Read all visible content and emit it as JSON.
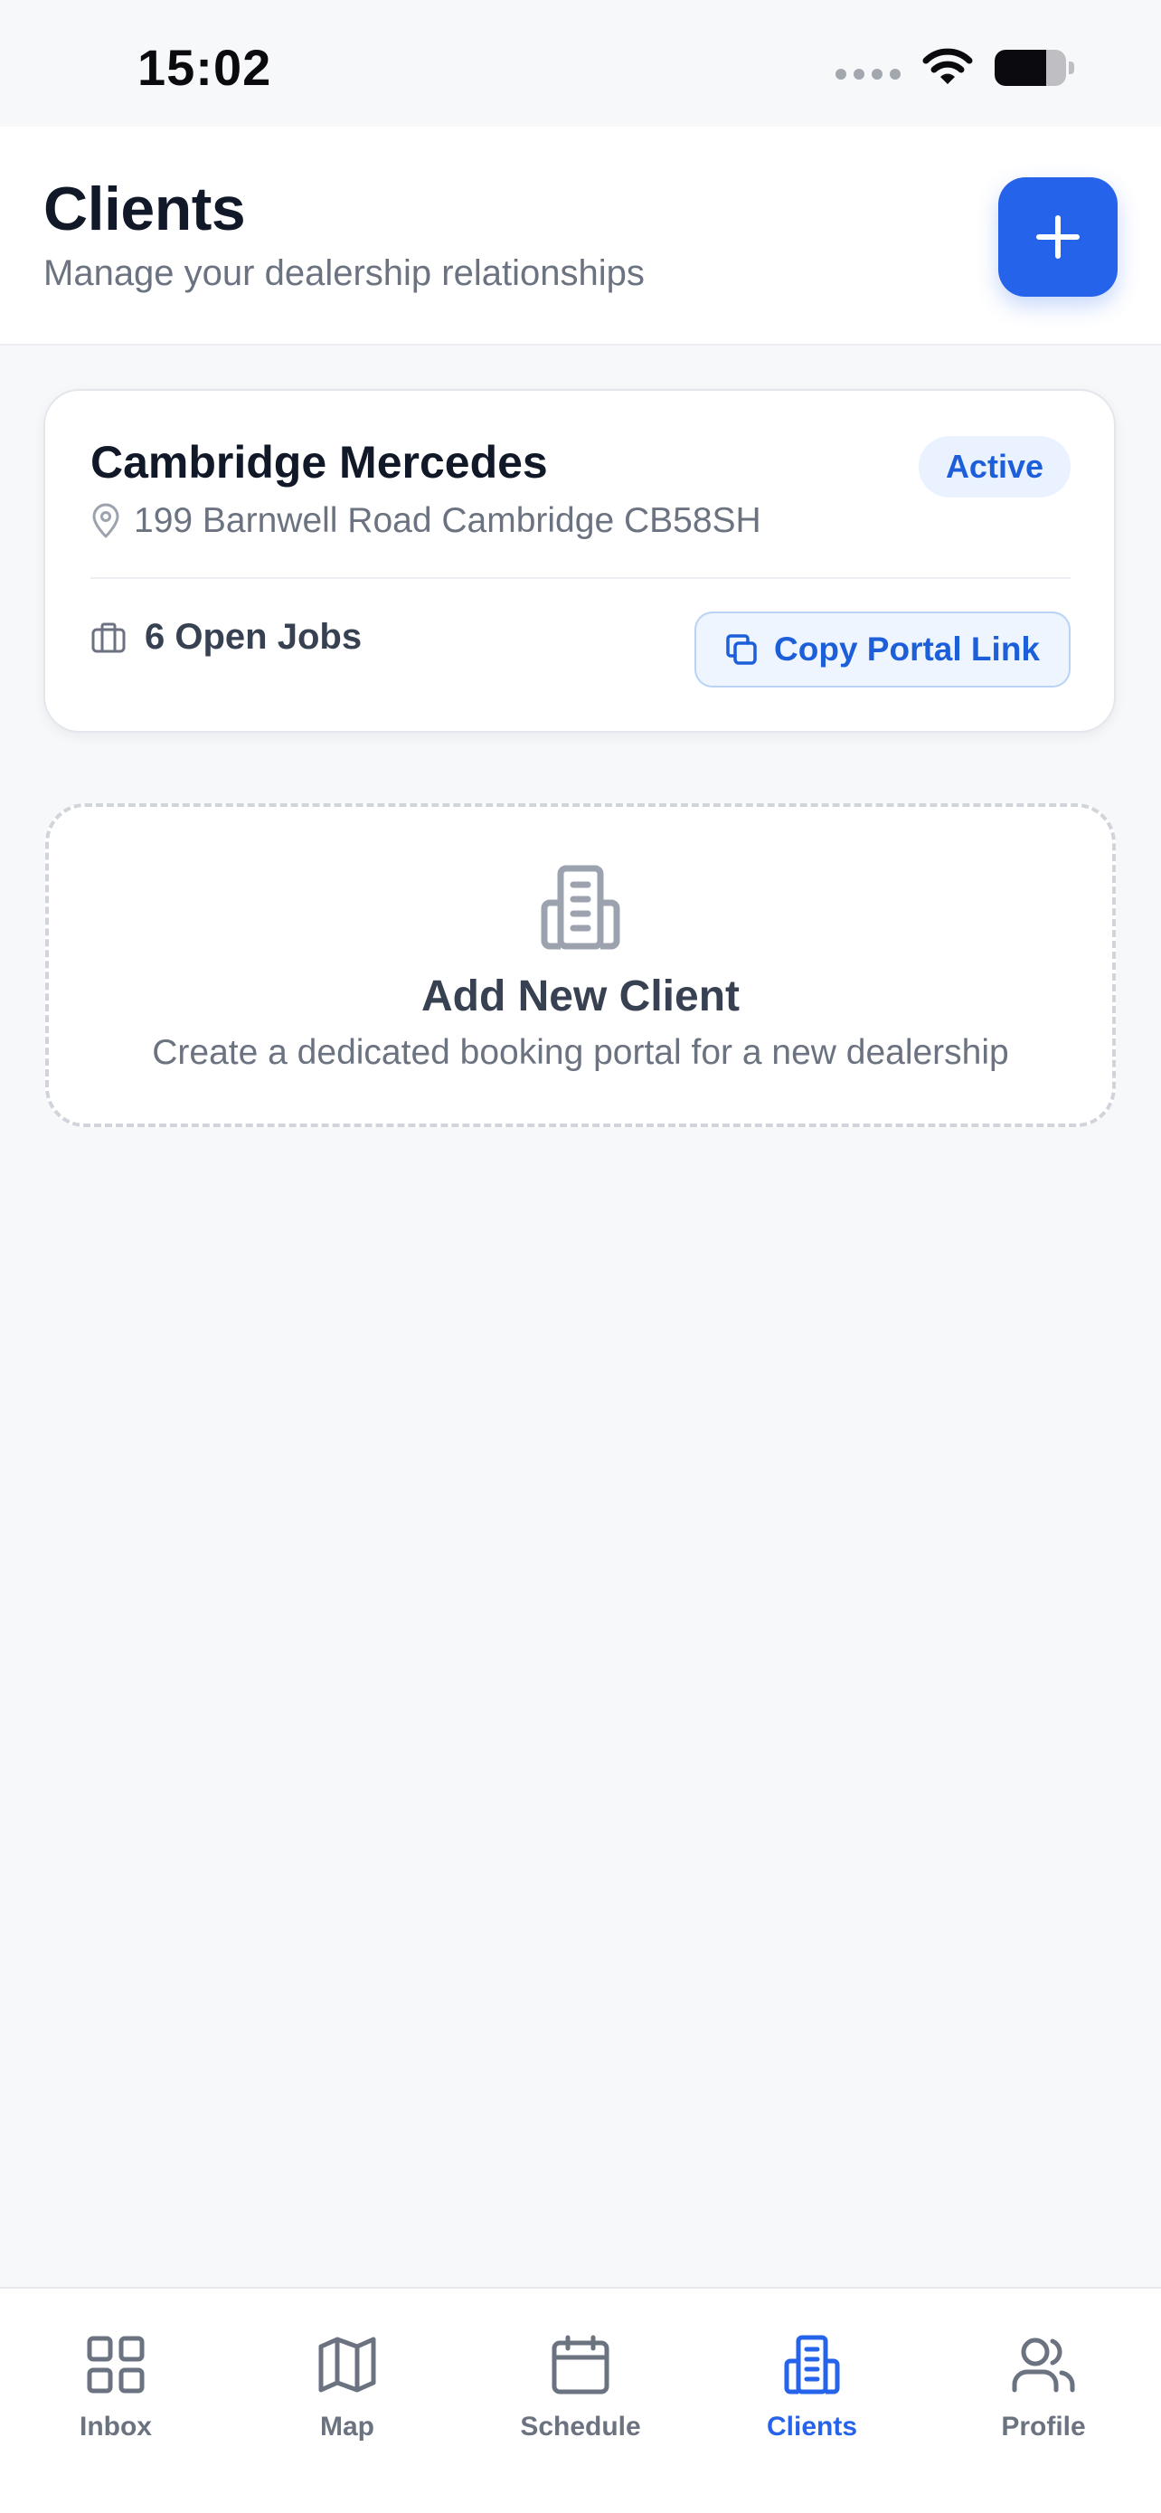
{
  "status_bar": {
    "time": "15:02",
    "battery_level": 0.72
  },
  "header": {
    "title": "Clients",
    "subtitle": "Manage your dealership relationships",
    "add_button_icon": "plus-icon"
  },
  "clients": [
    {
      "name": "Cambridge Mercedes",
      "status": "Active",
      "address": "199 Barnwell Road Cambridge CB58SH",
      "open_jobs_label": "6 Open Jobs",
      "copy_link_label": "Copy Portal Link"
    }
  ],
  "add_client": {
    "title": "Add New Client",
    "subtitle": "Create a dedicated booking portal for a new dealership",
    "icon": "building-icon"
  },
  "tab_bar": {
    "tabs": [
      {
        "label": "Inbox",
        "icon": "grid-icon",
        "active": false
      },
      {
        "label": "Map",
        "icon": "map-icon",
        "active": false
      },
      {
        "label": "Schedule",
        "icon": "calendar-icon",
        "active": false
      },
      {
        "label": "Clients",
        "icon": "building-icon",
        "active": true
      },
      {
        "label": "Profile",
        "icon": "users-icon",
        "active": false
      }
    ]
  },
  "colors": {
    "accent": "#2563eb",
    "badge_background": "#eaf2ff",
    "background": "#f7f8fa"
  }
}
